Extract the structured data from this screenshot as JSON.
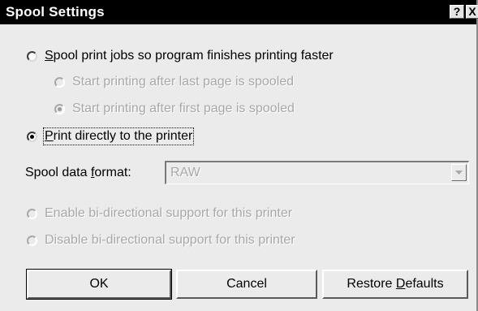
{
  "dialog": {
    "title": "Spool Settings",
    "help_label": "?",
    "close_label": "X"
  },
  "options": {
    "spool": {
      "before": "",
      "accel": "S",
      "after": "pool print jobs so program finishes printing faster",
      "checked": false
    },
    "after_last": {
      "text": "Start printing after last page is spooled",
      "checked": false,
      "enabled": false
    },
    "after_first": {
      "text": "Start printing after first page is spooled",
      "checked": true,
      "enabled": false
    },
    "direct": {
      "before": "",
      "accel": "P",
      "after": "rint directly to the printer",
      "checked": true
    }
  },
  "spool_format": {
    "label_before": "Spool data ",
    "label_accel": "f",
    "label_after": "ormat:",
    "value": "RAW"
  },
  "bidi": {
    "enable": "Enable bi-directional support for this printer",
    "disable": "Disable bi-directional support for this printer"
  },
  "buttons": {
    "ok": "OK",
    "cancel": "Cancel",
    "restore_before": "Restore ",
    "restore_accel": "D",
    "restore_after": "efaults"
  }
}
